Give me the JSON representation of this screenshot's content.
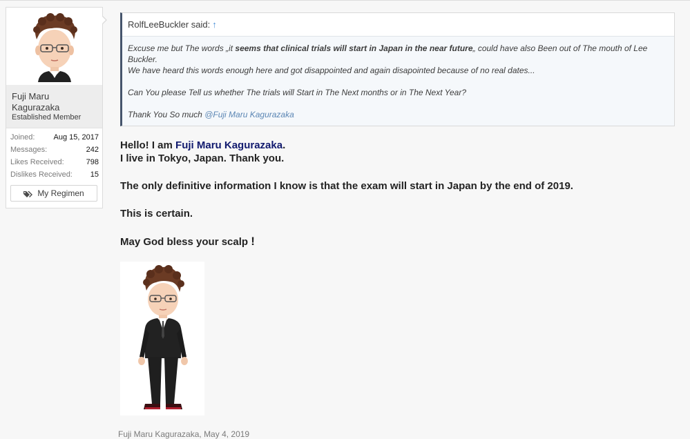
{
  "author": {
    "name": "Fuji Maru Kagurazaka",
    "title": "Established Member",
    "stats": [
      {
        "label": "Joined:",
        "value": "Aug 15, 2017"
      },
      {
        "label": "Messages:",
        "value": "242"
      },
      {
        "label": "Likes Received:",
        "value": "798"
      },
      {
        "label": "Dislikes Received:",
        "value": "15"
      }
    ],
    "regimen_button": "My Regimen"
  },
  "quote": {
    "author": "RolfLeeBuckler said:",
    "up_arrow": "↑",
    "line1_pre": "Excuse me but The words „it ",
    "line1_bold": "seems that clinical trials will start in Japan in the near future",
    "line1_post": "„ could have also Been out of The mouth of Lee Buckler.",
    "line2": "We have heard this words enough here and got disappointed and again disapointed because of no real dates...",
    "line3": "Can You please Tell us whether The trials will Start in The Next months or in The Next Year?",
    "line4_pre": "Thank You So much ",
    "mention": "@Fuji Maru Kagurazaka"
  },
  "message": {
    "hello_pre": "Hello! I am ",
    "hello_name": "Fuji Maru Kagurazaka",
    "hello_post": ".",
    "line2": "I live in Tokyo, Japan. Thank you.",
    "line3": "The only definitive information I know is that the exam will start in Japan by the end of 2019.",
    "line4": "This is certain.",
    "line5": "May God bless your scalp",
    "line5_excl": "!"
  },
  "footer": {
    "author": "Fuji Maru Kagurazaka",
    "date": "May 4, 2019"
  },
  "colors": {
    "quote_border": "#46556c",
    "mention": "#5b86b4",
    "name_highlight": "#111a6e"
  }
}
